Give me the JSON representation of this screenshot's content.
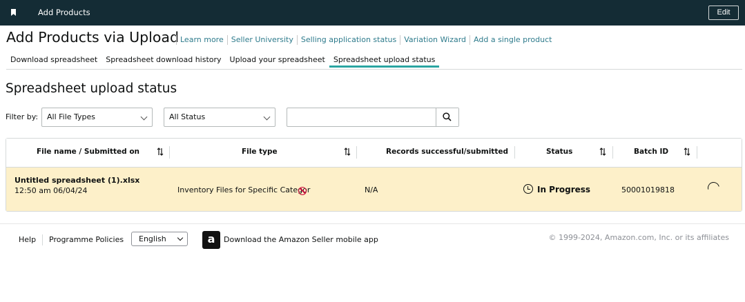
{
  "topbar": {
    "title": "Add Products",
    "edit_label": "Edit"
  },
  "page": {
    "title": "Add Products via Upload"
  },
  "header_links": [
    "Learn more",
    "Seller University",
    "Selling application status",
    "Variation Wizard",
    "Add a single product"
  ],
  "tabs": [
    {
      "label": "Download spreadsheet",
      "active": false
    },
    {
      "label": "Spreadsheet download history",
      "active": false
    },
    {
      "label": "Upload your spreadsheet",
      "active": false
    },
    {
      "label": "Spreadsheet upload status",
      "active": true
    }
  ],
  "section_title": "Spreadsheet upload status",
  "filters": {
    "label": "Filter by:",
    "file_type": "All File Types",
    "status": "All Status",
    "search_value": ""
  },
  "table": {
    "headers": {
      "file": "File name / Submitted on",
      "type": "File type",
      "records": "Records successful/submitted",
      "status": "Status",
      "batch": "Batch ID"
    },
    "rows": [
      {
        "file_name": "Untitled spreadsheet (1).xlsx",
        "submitted": "12:50 am 06/04/24",
        "file_type": "Inventory Files for Specific Categor",
        "records": "N/A",
        "status": "In Progress",
        "batch_id": "50001019818"
      }
    ]
  },
  "footer": {
    "help": "Help",
    "policies": "Programme Policies",
    "language": "English",
    "app_text": "Download the Amazon Seller mobile app",
    "app_icon": "a",
    "copyright": "© 1999-2024, Amazon.com, Inc. or its affiliates"
  },
  "colors": {
    "topbar": "#142c35",
    "link": "#2e7b8c",
    "active_tab": "#2aa5a1",
    "row_highlight": "#fdf0c9",
    "error_icon": "#cc0c39"
  }
}
